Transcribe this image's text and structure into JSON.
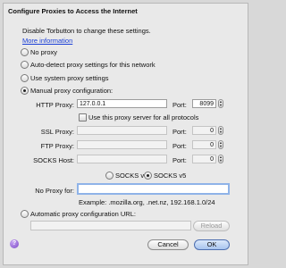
{
  "dialog": {
    "title": "Configure Proxies to Access the Internet",
    "notice": "Disable Torbutton to change these settings.",
    "more_info": "More information"
  },
  "options": {
    "no_proxy": "No proxy",
    "auto_detect": "Auto-detect proxy settings for this network",
    "system": "Use system proxy settings",
    "manual": "Manual proxy configuration:",
    "auto_url": "Automatic proxy configuration URL:"
  },
  "selected_option": "manual",
  "manual": {
    "http_label": "HTTP Proxy:",
    "http_value": "127.0.0.1",
    "port_label": "Port:",
    "http_port": "8099",
    "use_all_label": "Use this proxy server for all protocols",
    "use_all_checked": false,
    "ssl_label": "SSL Proxy:",
    "ssl_value": "",
    "ssl_port": "0",
    "ftp_label": "FTP Proxy:",
    "ftp_value": "",
    "ftp_port": "0",
    "socks_label": "SOCKS Host:",
    "socks_value": "",
    "socks_port": "0",
    "socks_v4": "SOCKS v4",
    "socks_v5": "SOCKS v5",
    "socks_version_selected": "v5",
    "no_proxy_label": "No Proxy for:",
    "no_proxy_value": "",
    "example": "Example: .mozilla.org, .net.nz, 192.168.1.0/24"
  },
  "auto_url_value": "",
  "buttons": {
    "reload": "Reload",
    "cancel": "Cancel",
    "ok": "OK",
    "help": "?"
  }
}
